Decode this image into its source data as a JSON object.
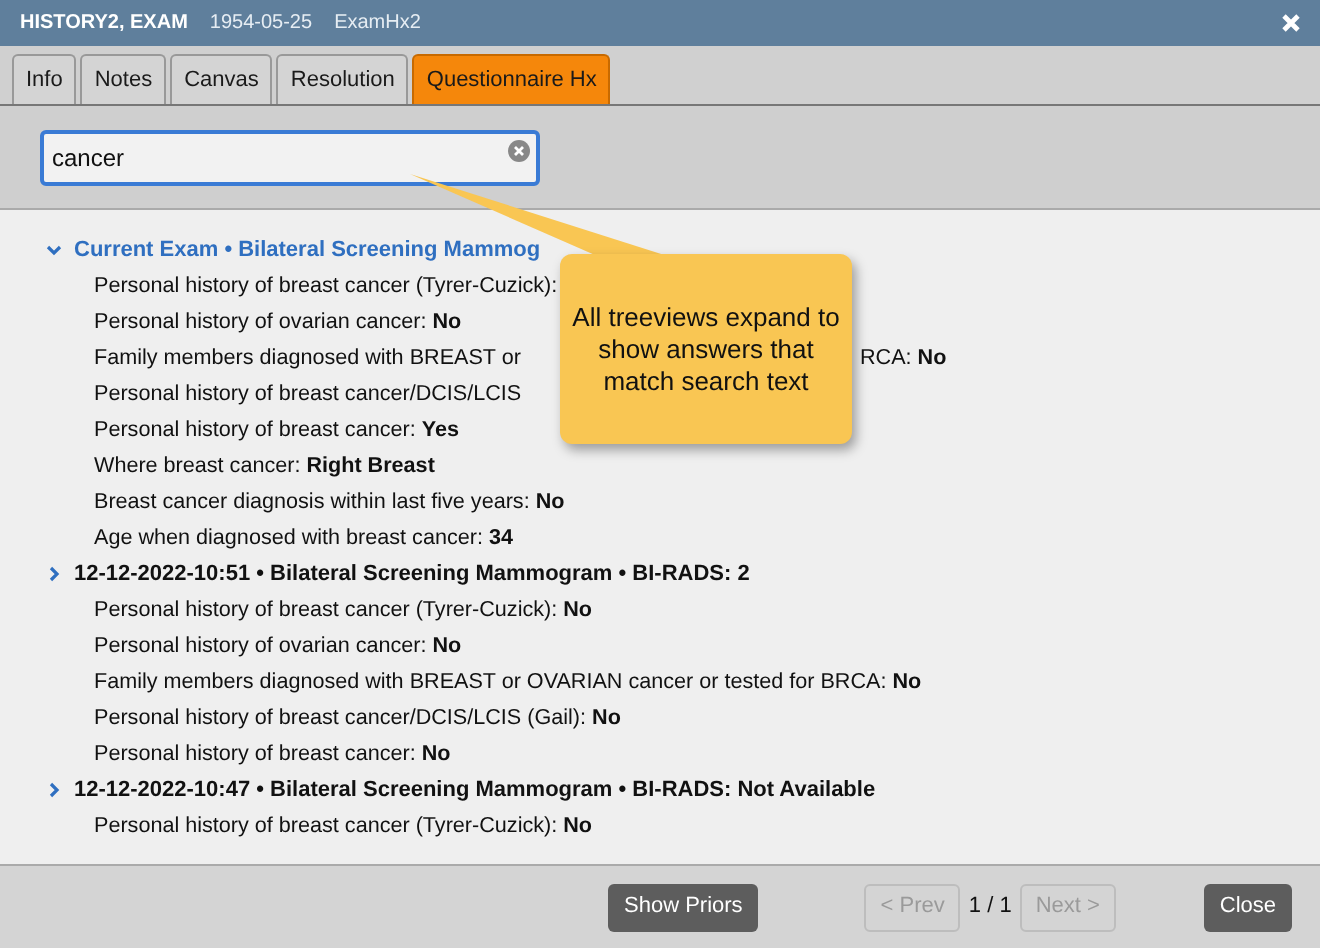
{
  "window": {
    "title": "HISTORY2, EXAM",
    "date": "1954-05-25",
    "exam_id": "ExamHx2"
  },
  "tabs": [
    {
      "label": "Info",
      "selected": false
    },
    {
      "label": "Notes",
      "selected": false
    },
    {
      "label": "Canvas",
      "selected": false
    },
    {
      "label": "Resolution",
      "selected": false
    },
    {
      "label": "Questionnaire Hx",
      "selected": true
    }
  ],
  "search": {
    "value": "cancer"
  },
  "groups": [
    {
      "title": "Current Exam • Bilateral Screening Mammog",
      "expanded": true,
      "rows": [
        {
          "label": "Personal history of breast cancer (Tyrer-Cuzick):"
        },
        {
          "label": "Personal history of ovarian cancer:",
          "value": "No"
        },
        {
          "label": "Family members diagnosed with BREAST or",
          "tail": "RCA:",
          "value": "No"
        },
        {
          "label": "Personal history of breast cancer/DCIS/LCIS"
        },
        {
          "label": "Personal history of breast cancer:",
          "value": "Yes"
        },
        {
          "label": "Where breast cancer:",
          "value": "Right Breast"
        },
        {
          "label": "Breast cancer diagnosis within last five years:",
          "value": "No"
        },
        {
          "label": "Age when diagnosed with breast cancer:",
          "value": "34"
        }
      ]
    },
    {
      "title": "12-12-2022-10:51 • Bilateral Screening Mammogram • BI-RADS: 2",
      "expanded": false,
      "rows": [
        {
          "label": "Personal history of breast cancer (Tyrer-Cuzick):",
          "value": "No"
        },
        {
          "label": "Personal history of ovarian cancer:",
          "value": "No"
        },
        {
          "label": "Family members diagnosed with BREAST or OVARIAN cancer or tested for BRCA:",
          "value": "No"
        },
        {
          "label": "Personal history of breast cancer/DCIS/LCIS (Gail):",
          "value": "No"
        },
        {
          "label": "Personal history of breast cancer:",
          "value": "No"
        }
      ]
    },
    {
      "title": "12-12-2022-10:47 • Bilateral Screening Mammogram • BI-RADS: Not Available",
      "expanded": false,
      "rows": [
        {
          "label": "Personal history of breast cancer (Tyrer-Cuzick):",
          "value": "No"
        }
      ]
    }
  ],
  "callout": {
    "text": "All treeviews expand to show answers that match search text"
  },
  "footer": {
    "show_priors": "Show Priors",
    "prev": {
      "label": "< Prev",
      "disabled": true
    },
    "page": "1 / 1",
    "next": {
      "label": "Next >",
      "disabled": true
    },
    "close": "Close"
  }
}
